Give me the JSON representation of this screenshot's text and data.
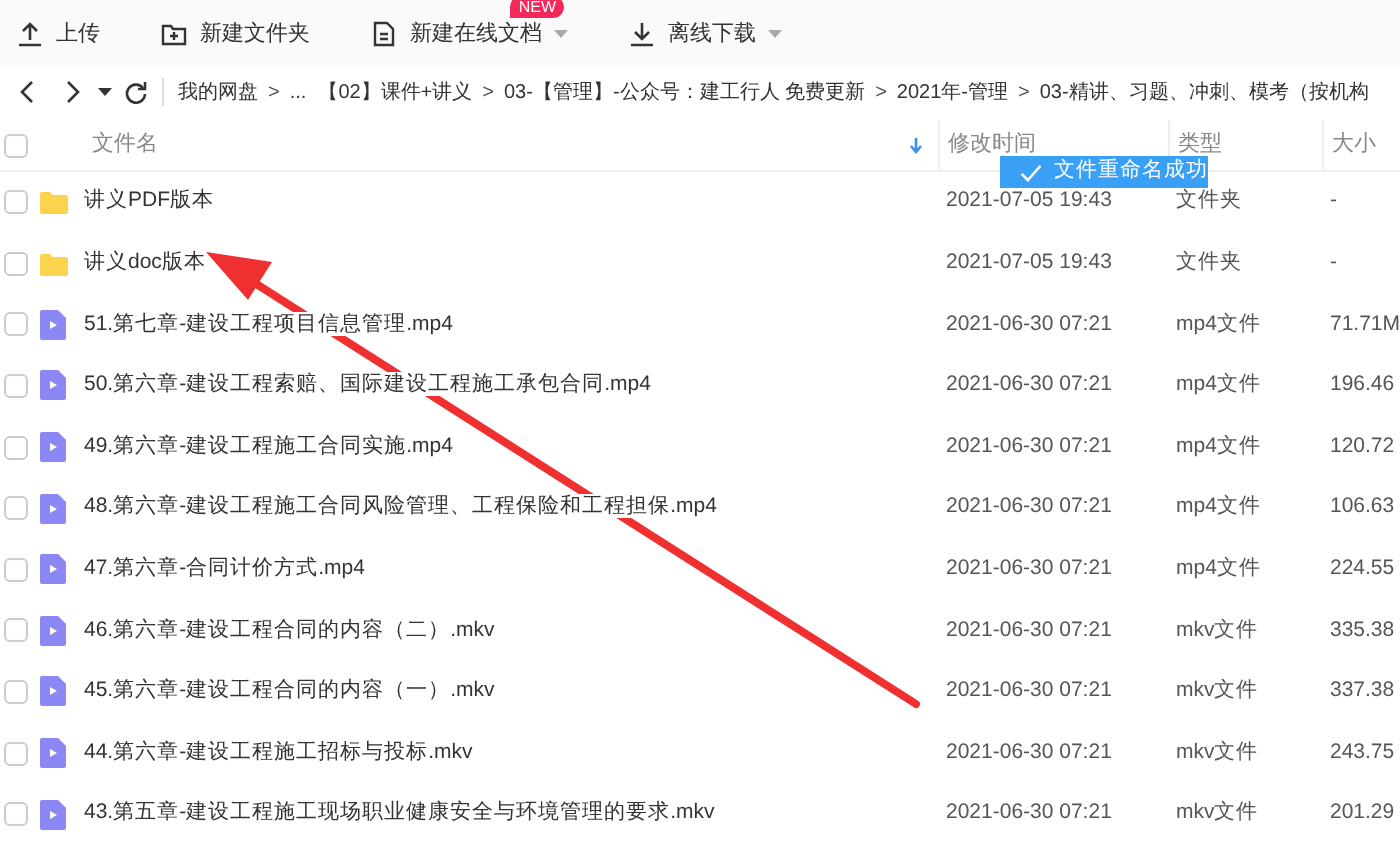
{
  "toolbar": [
    {
      "label": "上传",
      "caret": false
    },
    {
      "label": "新建文件夹",
      "caret": false
    },
    {
      "label": "新建在线文档",
      "caret": true,
      "badge": "NEW"
    },
    {
      "label": "离线下载",
      "caret": true
    }
  ],
  "breadcrumb": [
    {
      "kind": "crumb",
      "text": "我的网盘"
    },
    {
      "kind": "sep",
      "text": ">"
    },
    {
      "kind": "crumb",
      "text": "..."
    },
    {
      "kind": "crumb",
      "text": "【02】课件+讲义"
    },
    {
      "kind": "sep",
      "text": ">"
    },
    {
      "kind": "crumb",
      "text": "03-【管理】-公众号：建工行人 免费更新"
    },
    {
      "kind": "sep",
      "text": ">"
    },
    {
      "kind": "crumb",
      "text": "2021年-管理"
    },
    {
      "kind": "sep",
      "text": ">"
    },
    {
      "kind": "crumb",
      "text": "03-精讲、习题、冲刺、模考（按机构"
    }
  ],
  "table": {
    "select_all": {
      "checked": false
    },
    "columns": [
      {
        "label": "文件名",
        "sorted": true
      },
      {
        "label": "修改时间",
        "sorted": false
      },
      {
        "label": "类型",
        "sorted": false
      },
      {
        "label": "大小",
        "sorted": false
      }
    ],
    "rows": [
      {
        "kind": "folder",
        "checked": false,
        "name": "讲义PDF版本",
        "modified": "2021-07-05 19:43",
        "type": "文件夹",
        "size": "-"
      },
      {
        "kind": "folder",
        "checked": false,
        "name": "讲义doc版本",
        "modified": "2021-07-05 19:43",
        "type": "文件夹",
        "size": "-"
      },
      {
        "kind": "video",
        "checked": false,
        "name": "51.第七章-建设工程项目信息管理.mp4",
        "modified": "2021-06-30 07:21",
        "type": "mp4文件",
        "size": "71.71M"
      },
      {
        "kind": "video",
        "checked": false,
        "name": "50.第六章-建设工程索赔、国际建设工程施工承包合同.mp4",
        "modified": "2021-06-30 07:21",
        "type": "mp4文件",
        "size": "196.46"
      },
      {
        "kind": "video",
        "checked": false,
        "name": "49.第六章-建设工程施工合同实施.mp4",
        "modified": "2021-06-30 07:21",
        "type": "mp4文件",
        "size": "120.72"
      },
      {
        "kind": "video",
        "checked": false,
        "name": "48.第六章-建设工程施工合同风险管理、工程保险和工程担保.mp4",
        "modified": "2021-06-30 07:21",
        "type": "mp4文件",
        "size": "106.63"
      },
      {
        "kind": "video",
        "checked": false,
        "name": "47.第六章-合同计价方式.mp4",
        "modified": "2021-06-30 07:21",
        "type": "mp4文件",
        "size": "224.55"
      },
      {
        "kind": "video",
        "checked": false,
        "name": "46.第六章-建设工程合同的内容（二）.mkv",
        "modified": "2021-06-30 07:21",
        "type": "mkv文件",
        "size": "335.38"
      },
      {
        "kind": "video",
        "checked": false,
        "name": "45.第六章-建设工程合同的内容（一）.mkv",
        "modified": "2021-06-30 07:21",
        "type": "mkv文件",
        "size": "337.38"
      },
      {
        "kind": "video",
        "checked": false,
        "name": "44.第六章-建设工程施工招标与投标.mkv",
        "modified": "2021-06-30 07:21",
        "type": "mkv文件",
        "size": "243.75"
      },
      {
        "kind": "video",
        "checked": false,
        "name": "43.第五章-建设工程施工现场职业健康安全与环境管理的要求.mkv",
        "modified": "2021-06-30 07:21",
        "type": "mkv文件",
        "size": "201.29"
      }
    ]
  },
  "toast": {
    "text": "文件重命名成功"
  },
  "annotation": {
    "kind": "arrow"
  }
}
